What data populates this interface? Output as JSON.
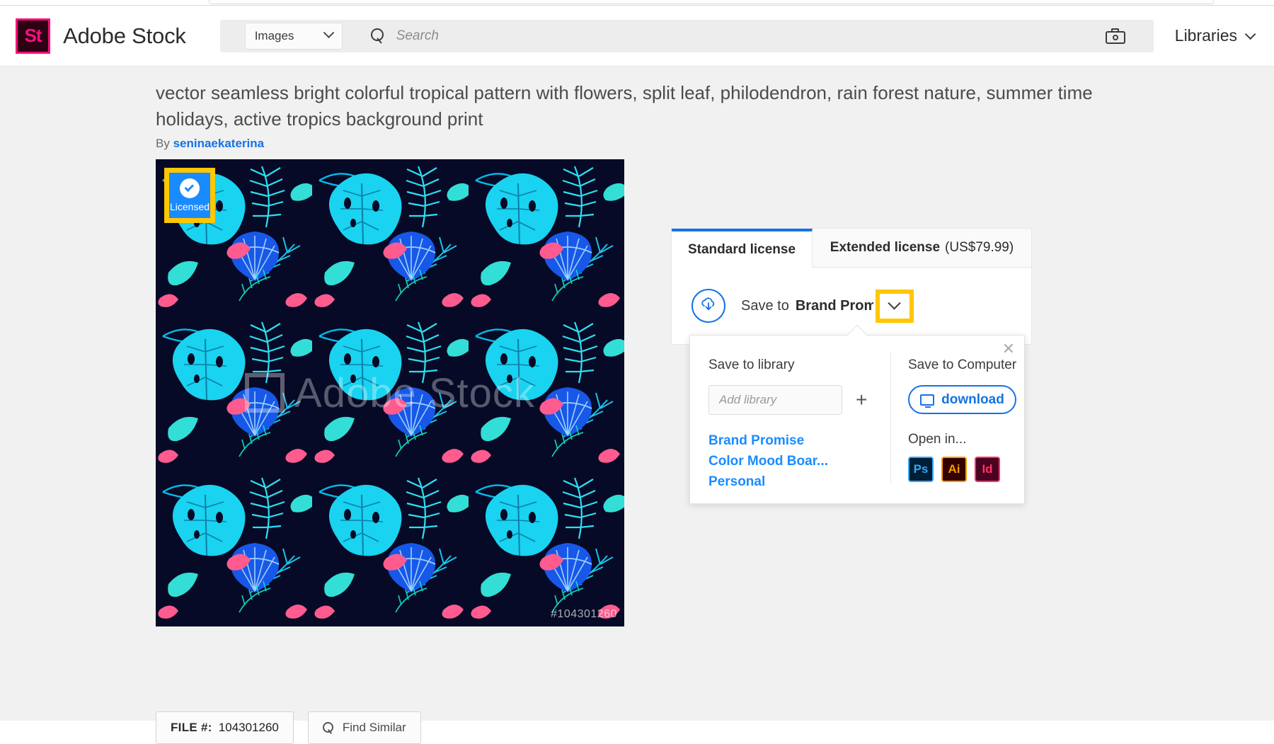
{
  "browser": {
    "address_bar": ""
  },
  "header": {
    "logo_text": "St",
    "brand": "Adobe Stock",
    "category_select": {
      "label": "Images",
      "icon": "chevron-down-icon"
    },
    "search": {
      "placeholder": "Search",
      "value": "",
      "icon": "search-icon"
    },
    "camera_icon": "camera-icon",
    "libraries": {
      "label": "Libraries",
      "icon": "chevron-down-icon"
    }
  },
  "asset": {
    "title": "vector seamless bright colorful tropical pattern with flowers, split leaf, philodendron, rain forest nature, summer time holidays, active tropics background print",
    "by_label": "By",
    "author": "seninaekaterina",
    "licensed_badge": {
      "label": "Licensed",
      "icon": "check-circle-icon"
    },
    "watermark": "Adobe Stock",
    "watermark_fileno": "#104301260",
    "file_number_label": "FILE #:",
    "file_number": "104301260",
    "find_similar": "Find Similar",
    "find_similar_icon": "search-icon"
  },
  "license_card": {
    "tabs": [
      {
        "label": "Standard license",
        "price": "",
        "active": true
      },
      {
        "label": "Extended license",
        "price": "(US$79.99)",
        "active": false
      }
    ],
    "save_row": {
      "cloud_icon": "cloud-download-icon",
      "save_to_label": "Save to",
      "save_to_value": "Brand Promis",
      "dropdown_icon": "chevron-down-icon"
    }
  },
  "dropdown": {
    "close_icon": "close-icon",
    "left": {
      "heading": "Save to library",
      "input_placeholder": "Add library",
      "input_value": "",
      "add_icon": "plus-icon",
      "libraries": [
        "Brand Promise",
        "Color Mood Boar...",
        "Personal"
      ]
    },
    "right": {
      "heading": "Save to Computer",
      "download_label": "download",
      "download_icon": "monitor-icon",
      "open_in_label": "Open in...",
      "apps": [
        {
          "name": "Ps",
          "bg": "#001e36",
          "border": "#31a8ff",
          "fg": "#31a8ff"
        },
        {
          "name": "Ai",
          "bg": "#330000",
          "border": "#ff9a00",
          "fg": "#ff9a00"
        },
        {
          "name": "Id",
          "bg": "#49021f",
          "border": "#ff3366",
          "fg": "#ff3366"
        }
      ]
    }
  },
  "colors": {
    "accent_blue": "#1473e6",
    "link_blue": "#1a8cff",
    "highlight_yellow": "#ffc700",
    "brand_pink": "#fa0f7b"
  }
}
